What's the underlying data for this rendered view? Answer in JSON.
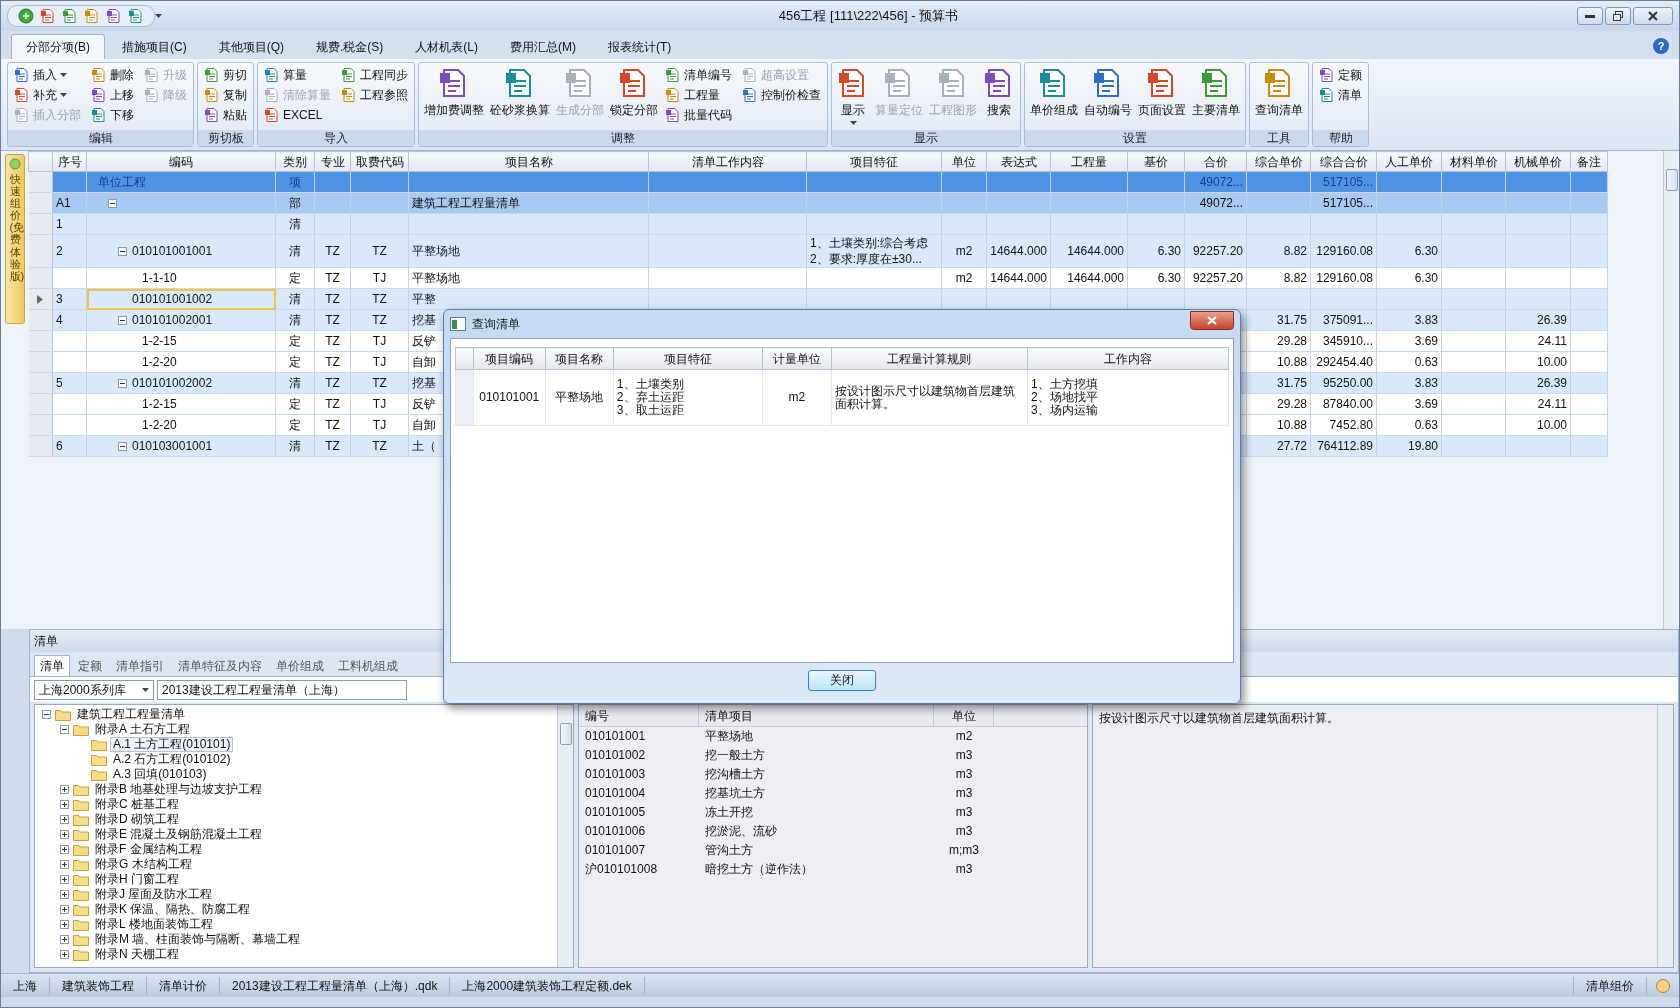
{
  "window": {
    "title": "456工程 [111\\222\\456] - 预算书"
  },
  "ribbon": {
    "tabs": [
      {
        "label": "分部分项(B)",
        "selected": true
      },
      {
        "label": "措施项目(C)",
        "selected": false
      },
      {
        "label": "其他项目(Q)",
        "selected": false
      },
      {
        "label": "规费.税金(S)",
        "selected": false
      },
      {
        "label": "人材机表(L)",
        "selected": false
      },
      {
        "label": "费用汇总(M)",
        "selected": false
      },
      {
        "label": "报表统计(T)",
        "selected": false
      }
    ],
    "help_button": "?",
    "groups": [
      {
        "label": "编辑",
        "items": [
          {
            "label": "插入",
            "kind": "small",
            "dropdown": true,
            "disabled": false
          },
          {
            "label": "补充",
            "kind": "small",
            "dropdown": true,
            "disabled": false
          },
          {
            "label": "插入分部",
            "kind": "small",
            "dropdown": false,
            "disabled": true
          },
          {
            "label": "删除",
            "kind": "small",
            "dropdown": false,
            "disabled": false
          },
          {
            "label": "上移",
            "kind": "small",
            "dropdown": false,
            "disabled": false
          },
          {
            "label": "下移",
            "kind": "small",
            "dropdown": false,
            "disabled": false
          },
          {
            "label": "升级",
            "kind": "small",
            "dropdown": false,
            "disabled": true
          },
          {
            "label": "降级",
            "kind": "small",
            "dropdown": false,
            "disabled": true
          }
        ]
      },
      {
        "label": "剪切板",
        "items": [
          {
            "label": "剪切",
            "kind": "small",
            "dropdown": false,
            "disabled": false
          },
          {
            "label": "复制",
            "kind": "small",
            "dropdown": false,
            "disabled": false
          },
          {
            "label": "粘贴",
            "kind": "small",
            "dropdown": false,
            "disabled": false
          }
        ]
      },
      {
        "label": "导入",
        "items": [
          {
            "label": "算量",
            "kind": "small",
            "dropdown": false,
            "disabled": false
          },
          {
            "label": "清除算量",
            "kind": "small",
            "dropdown": false,
            "disabled": true
          },
          {
            "label": "EXCEL",
            "kind": "small",
            "dropdown": false,
            "disabled": false
          },
          {
            "label": "工程同步",
            "kind": "small",
            "dropdown": false,
            "disabled": false
          },
          {
            "label": "工程参照",
            "kind": "small",
            "dropdown": false,
            "disabled": false
          }
        ]
      },
      {
        "label": "调整",
        "items": [
          {
            "label": "增加费调整",
            "kind": "large",
            "dropdown": false,
            "disabled": false
          },
          {
            "label": "砼砂浆换算",
            "kind": "large",
            "dropdown": false,
            "disabled": false
          },
          {
            "label": "生成分部",
            "kind": "large",
            "dropdown": false,
            "disabled": true
          },
          {
            "label": "锁定分部",
            "kind": "large",
            "dropdown": false,
            "disabled": false
          },
          {
            "label": "清单编号",
            "kind": "small",
            "dropdown": false,
            "disabled": false
          },
          {
            "label": "工程量",
            "kind": "small",
            "dropdown": false,
            "disabled": false
          },
          {
            "label": "批量代码",
            "kind": "small",
            "dropdown": false,
            "disabled": false
          },
          {
            "label": "超高设置",
            "kind": "small",
            "dropdown": false,
            "disabled": true
          },
          {
            "label": "控制价检查",
            "kind": "small",
            "dropdown": false,
            "disabled": false
          }
        ]
      },
      {
        "label": "显示",
        "items": [
          {
            "label": "显示",
            "kind": "large",
            "dropdown": true,
            "disabled": false
          },
          {
            "label": "算量定位",
            "kind": "large",
            "dropdown": false,
            "disabled": true
          },
          {
            "label": "工程图形",
            "kind": "large",
            "dropdown": false,
            "disabled": true
          },
          {
            "label": "搜索",
            "kind": "large",
            "dropdown": false,
            "disabled": false
          }
        ]
      },
      {
        "label": "设置",
        "items": [
          {
            "label": "单价组成",
            "kind": "large",
            "dropdown": false,
            "disabled": false
          },
          {
            "label": "自动编号",
            "kind": "large",
            "dropdown": false,
            "disabled": false
          },
          {
            "label": "页面设置",
            "kind": "large",
            "dropdown": false,
            "disabled": false
          },
          {
            "label": "主要清单",
            "kind": "large",
            "dropdown": false,
            "disabled": false
          }
        ]
      },
      {
        "label": "工具",
        "items": [
          {
            "label": "查询清单",
            "kind": "large",
            "dropdown": false,
            "disabled": false
          }
        ]
      },
      {
        "label": "帮助",
        "items": [
          {
            "label": "定额",
            "kind": "small",
            "dropdown": false,
            "disabled": false
          },
          {
            "label": "清单",
            "kind": "small",
            "dropdown": false,
            "disabled": false
          }
        ]
      }
    ]
  },
  "side_tab": {
    "label": "快速组价(免费体验版)"
  },
  "grid": {
    "columns": [
      "序号",
      "编码",
      "类别",
      "专业",
      "取费代码",
      "项目名称",
      "清单工作内容",
      "项目特征",
      "单位",
      "表达式",
      "工程量",
      "基价",
      "合价",
      "综合单价",
      "综合合价",
      "人工单价",
      "材料单价",
      "机械单价",
      "备注"
    ],
    "rows": [
      {
        "kind": "unit",
        "selected": false,
        "cells": [
          null,
          "单位工程",
          "项",
          null,
          null,
          null,
          null,
          null,
          null,
          null,
          null,
          null,
          "49072...",
          null,
          "517105...",
          null,
          null,
          null,
          null
        ],
        "children": [
          {
            "kind": "section",
            "selected": false,
            "expanded": true,
            "cells": [
              "A1",
              null,
              "部",
              null,
              null,
              "建筑工程工程量清单",
              null,
              null,
              null,
              null,
              null,
              null,
              "49072...",
              null,
              "517105...",
              null,
              null,
              null,
              null
            ],
            "children": [
              {
                "kind": "bill",
                "selected": false,
                "cells": [
                  "1",
                  null,
                  "清",
                  null,
                  null,
                  null,
                  null,
                  null,
                  null,
                  null,
                  null,
                  null,
                  null,
                  null,
                  null,
                  null,
                  null,
                  null,
                  null
                ]
              },
              {
                "kind": "bill",
                "selected": false,
                "expanded": true,
                "cells": [
                  "2",
                  "010101001001",
                  "清",
                  "TZ",
                  "TZ",
                  "平整场地",
                  null,
                  "1、土壤类别:综合考虑\n2、要求:厚度在±30...",
                  "m2",
                  "14644.000",
                  "14644.000",
                  "6.30",
                  "92257.20",
                  "8.82",
                  "129160.08",
                  "6.30",
                  null,
                  null,
                  null
                ],
                "children": [
                  {
                    "kind": "quota",
                    "selected": false,
                    "cells": [
                      null,
                      "1-1-10",
                      "定",
                      "TZ",
                      "TJ",
                      "平整场地",
                      null,
                      null,
                      "m2",
                      "14644.000",
                      "14644.000",
                      "6.30",
                      "92257.20",
                      "8.82",
                      "129160.08",
                      "6.30",
                      null,
                      null,
                      null
                    ]
                  }
                ]
              },
              {
                "kind": "bill",
                "selected": true,
                "cells": [
                  "3",
                  "010101001002",
                  "清",
                  "TZ",
                  "TZ",
                  "平整",
                  null,
                  null,
                  null,
                  null,
                  null,
                  null,
                  null,
                  null,
                  null,
                  null,
                  null,
                  null,
                  null
                ]
              },
              {
                "kind": "bill",
                "selected": false,
                "expanded": true,
                "cells": [
                  "4",
                  "010101002001",
                  "清",
                  "TZ",
                  "TZ",
                  "挖基",
                  null,
                  null,
                  null,
                  null,
                  null,
                  null,
                  null,
                  "31.75",
                  "375091...",
                  "3.83",
                  null,
                  "26.39",
                  null
                ],
                "children": [
                  {
                    "kind": "quota",
                    "selected": false,
                    "cells": [
                      null,
                      "1-2-15",
                      "定",
                      "TZ",
                      "TJ",
                      "反铲",
                      null,
                      null,
                      null,
                      null,
                      null,
                      null,
                      null,
                      "29.28",
                      "345910...",
                      "3.69",
                      null,
                      "24.11",
                      null
                    ]
                  },
                  {
                    "kind": "quota",
                    "selected": false,
                    "cells": [
                      null,
                      "1-2-20",
                      "定",
                      "TZ",
                      "TJ",
                      "自卸",
                      null,
                      null,
                      null,
                      null,
                      null,
                      null,
                      null,
                      "10.88",
                      "292454.40",
                      "0.63",
                      null,
                      "10.00",
                      null
                    ]
                  }
                ]
              },
              {
                "kind": "bill",
                "selected": false,
                "expanded": true,
                "cells": [
                  "5",
                  "010101002002",
                  "清",
                  "TZ",
                  "TZ",
                  "挖基",
                  null,
                  null,
                  null,
                  null,
                  null,
                  null,
                  null,
                  "31.75",
                  "95250.00",
                  "3.83",
                  null,
                  "26.39",
                  null
                ],
                "children": [
                  {
                    "kind": "quota",
                    "selected": false,
                    "cells": [
                      null,
                      "1-2-15",
                      "定",
                      "TZ",
                      "TJ",
                      "反铲",
                      null,
                      null,
                      null,
                      null,
                      null,
                      null,
                      null,
                      "29.28",
                      "87840.00",
                      "3.69",
                      null,
                      "24.11",
                      null
                    ]
                  },
                  {
                    "kind": "quota",
                    "selected": false,
                    "cells": [
                      null,
                      "1-2-20",
                      "定",
                      "TZ",
                      "TJ",
                      "自卸",
                      null,
                      null,
                      null,
                      null,
                      null,
                      null,
                      null,
                      "10.88",
                      "7452.80",
                      "0.63",
                      null,
                      "10.00",
                      null
                    ]
                  }
                ]
              },
              {
                "kind": "bill",
                "selected": false,
                "expanded": true,
                "cells": [
                  "6",
                  "010103001001",
                  "清",
                  "TZ",
                  "TZ",
                  "土（",
                  null,
                  null,
                  null,
                  null,
                  null,
                  null,
                  null,
                  "27.72",
                  "764112.89",
                  "19.80",
                  null,
                  null,
                  null
                ]
              }
            ]
          }
        ]
      }
    ]
  },
  "bottom_panel": {
    "title": "清单",
    "tabs": [
      {
        "label": "清单",
        "selected": true
      },
      {
        "label": "定额",
        "selected": false
      },
      {
        "label": "清单指引",
        "selected": false
      },
      {
        "label": "清单特征及内容",
        "selected": false
      },
      {
        "label": "单价组成",
        "selected": false
      },
      {
        "label": "工料机组成",
        "selected": false
      }
    ],
    "library": "上海2000系列库",
    "list_set": "2013建设工程工程量清单（上海）",
    "tree": [
      {
        "label": "建筑工程工程量清单",
        "expanded": true,
        "selected": false,
        "children": [
          {
            "label": "附录A 土石方工程",
            "expanded": true,
            "selected": false,
            "children": [
              {
                "label": "A.1 土方工程(010101)",
                "selected": true
              },
              {
                "label": "A.2 石方工程(010102)",
                "selected": false
              },
              {
                "label": "A.3 回填(010103)",
                "selected": false
              }
            ]
          },
          {
            "label": "附录B 地基处理与边坡支护工程",
            "expanded": false,
            "selected": false
          },
          {
            "label": "附录C 桩基工程",
            "expanded": false,
            "selected": false
          },
          {
            "label": "附录D 砌筑工程",
            "expanded": false,
            "selected": false
          },
          {
            "label": "附录E 混凝土及钢筋混凝土工程",
            "expanded": false,
            "selected": false
          },
          {
            "label": "附录F 金属结构工程",
            "expanded": false,
            "selected": false
          },
          {
            "label": "附录G 木结构工程",
            "expanded": false,
            "selected": false
          },
          {
            "label": "附录H 门窗工程",
            "expanded": false,
            "selected": false
          },
          {
            "label": "附录J 屋面及防水工程",
            "expanded": false,
            "selected": false
          },
          {
            "label": "附录K 保温、隔热、防腐工程",
            "expanded": false,
            "selected": false
          },
          {
            "label": "附录L 楼地面装饰工程",
            "expanded": false,
            "selected": false
          },
          {
            "label": "附录M 墙、柱面装饰与隔断、幕墙工程",
            "expanded": false,
            "selected": false
          },
          {
            "label": "附录N 天棚工程",
            "expanded": false,
            "selected": false
          }
        ]
      }
    ],
    "list": {
      "columns": [
        "编号",
        "清单项目",
        "单位"
      ],
      "rows": [
        {
          "code": "010101001",
          "name": "平整场地",
          "unit": "m2"
        },
        {
          "code": "010101002",
          "name": "挖一般土方",
          "unit": "m3"
        },
        {
          "code": "010101003",
          "name": "挖沟槽土方",
          "unit": "m3"
        },
        {
          "code": "010101004",
          "name": "挖基坑土方",
          "unit": "m3"
        },
        {
          "code": "010101005",
          "name": "冻土开挖",
          "unit": "m3"
        },
        {
          "code": "010101006",
          "name": "挖淤泥、流砂",
          "unit": "m3"
        },
        {
          "code": "010101007",
          "name": "管沟土方",
          "unit": "m;m3"
        },
        {
          "code": "沪010101008",
          "name": "暗挖土方（逆作法）",
          "unit": "m3"
        }
      ]
    },
    "description": "按设计图示尺寸以建筑物首层建筑面积计算。"
  },
  "dialog": {
    "title": "查询清单",
    "columns": [
      "项目编码",
      "项目名称",
      "项目特征",
      "计量单位",
      "工程量计算规则",
      "工作内容"
    ],
    "rows": [
      {
        "cells": [
          "010101001",
          "平整场地",
          "1、土壤类别\n2、弃土运距\n3、取土运距",
          "m2",
          "按设计图示尺寸以建筑物首层建筑面积计算。",
          "1、土方挖填\n2、场地找平\n3、场内运输"
        ]
      }
    ],
    "close_button": "关闭"
  },
  "status_bar": {
    "items": [
      "上海",
      "建筑装饰工程",
      "清单计价",
      "2013建设工程工程量清单（上海）.qdk",
      "上海2000建筑装饰工程定额.dek"
    ],
    "mode": "清单组价"
  }
}
